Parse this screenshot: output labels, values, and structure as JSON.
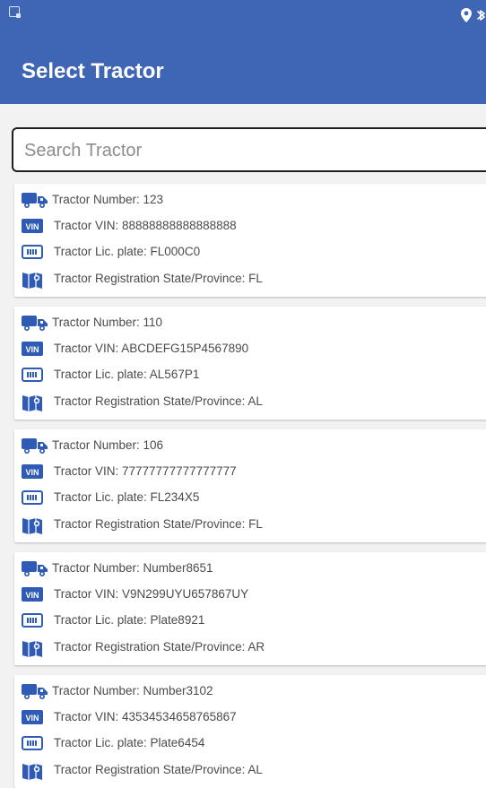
{
  "screen": {
    "title": "Select Tractor"
  },
  "search": {
    "placeholder": "Search Tractor",
    "value": ""
  },
  "tractors": [
    {
      "number": "Tractor Number: 123",
      "vin": "Tractor VIN: 88888888888888888",
      "plate": "Tractor Lic. plate: FL000C0",
      "state": "Tractor Registration State/Province: FL"
    },
    {
      "number": "Tractor Number: 110",
      "vin": "Tractor VIN: ABCDEFG15P4567890",
      "plate": "Tractor Lic. plate: AL567P1",
      "state": "Tractor Registration State/Province: AL"
    },
    {
      "number": "Tractor Number: 106",
      "vin": "Tractor VIN: 77777777777777777",
      "plate": "Tractor Lic. plate: FL234X5",
      "state": "Tractor Registration State/Province: FL"
    },
    {
      "number": "Tractor Number: Number8651",
      "vin": "Tractor VIN: V9N299UYU657867UY",
      "plate": "Tractor Lic. plate: Plate8921",
      "state": "Tractor Registration State/Province: AR"
    },
    {
      "number": "Tractor Number: Number3102",
      "vin": "Tractor VIN: 43534534658765867",
      "plate": "Tractor Lic. plate: Plate6454",
      "state": "Tractor Registration State/Province: AL"
    }
  ],
  "icons": {
    "truck": "truck-icon",
    "vin": "vin-badge-icon",
    "plate": "license-plate-icon",
    "map": "map-icon",
    "status_left": "notification-icon",
    "location": "location-icon",
    "bluetooth": "bluetooth-icon"
  },
  "colors": {
    "primary": "#3f66b4",
    "icon_blue": "#2f5bb6",
    "text": "#4b4b4b",
    "placeholder": "#8d8d8d"
  },
  "vin_badge_text": "VIN"
}
